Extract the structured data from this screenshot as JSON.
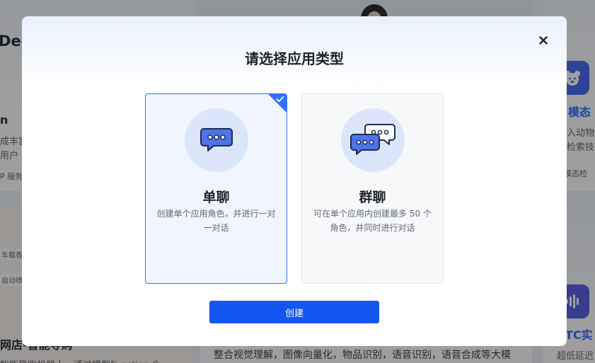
{
  "background": {
    "card1": {
      "title": "Dee",
      "name": "n",
      "line1": "成丰富",
      "line2": "用户 ;",
      "tag": "P 服务"
    },
    "card_right": {
      "title": "模态",
      "line1": "入动物",
      "line2": "检索技",
      "tag": "模态检"
    },
    "card_left_bottom": {
      "tag1": "车载香氛",
      "tag2": "自动喷雾",
      "title": "网店-智能导购",
      "desc": "智能导购机器人，通过模型Function C"
    },
    "card_mid_bottom": {
      "desc": "整合视觉理解，图像向量化，物品识别，语音识别，语音合成等大模"
    },
    "card_right_bottom": {
      "title": "TC实",
      "desc": "超低延迟"
    }
  },
  "modal": {
    "title": "请选择应用类型",
    "close_icon": "close-icon",
    "options": [
      {
        "title": "单聊",
        "desc": "创建单个应用角色，并进行一对一对话",
        "icon": "single-chat-icon",
        "selected": true
      },
      {
        "title": "群聊",
        "desc": "可在单个应用内创建最多 50 个角色，并同时进行对话",
        "icon": "group-chat-icon",
        "selected": false
      }
    ],
    "create_label": "创建"
  },
  "colors": {
    "accent": "#3370ff",
    "primary_button": "#1456f0",
    "icon_circle": "#dce6fb"
  }
}
